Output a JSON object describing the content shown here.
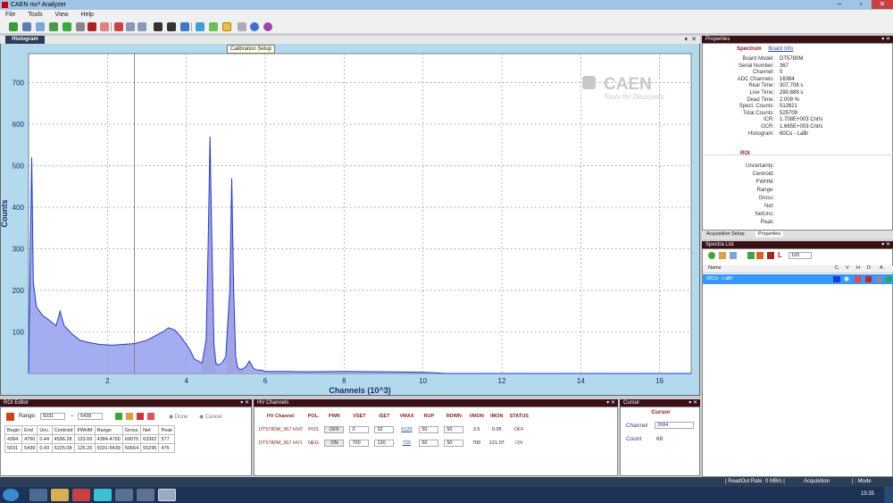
{
  "app": {
    "title": "CAEN mc² Analyzer"
  },
  "menu": [
    "File",
    "Tools",
    "View",
    "Help"
  ],
  "tooltip": "Calibration Setup",
  "histogram": {
    "tab": "Histogram",
    "logo_text": "CAEN",
    "logo_tagline": "Tools for Discovery"
  },
  "chart_data": {
    "type": "area",
    "xlabel": "Channels (10^3)",
    "ylabel": "Counts",
    "xlim": [
      0,
      16.8
    ],
    "ylim": [
      0,
      770
    ],
    "x_ticks": [
      2,
      4,
      6,
      8,
      10,
      12,
      14,
      16
    ],
    "y_ticks": [
      100,
      200,
      300,
      400,
      500,
      600,
      700
    ],
    "grid": true,
    "cursor_x": 2.684,
    "series": [
      {
        "name": "60Co - LaBr",
        "color": "#1f3bd6",
        "fill": "#9aa4ee",
        "x": [
          0.0,
          0.08,
          0.12,
          0.2,
          0.35,
          0.5,
          0.7,
          0.8,
          0.9,
          1.1,
          1.3,
          1.5,
          1.8,
          2.1,
          2.4,
          2.7,
          3.0,
          3.2,
          3.4,
          3.55,
          3.7,
          3.85,
          4.0,
          4.1,
          4.2,
          4.3,
          4.4,
          4.5,
          4.55,
          4.6,
          4.65,
          4.7,
          4.75,
          4.8,
          4.9,
          5.0,
          5.1,
          5.15,
          5.2,
          5.25,
          5.3,
          5.35,
          5.4,
          5.5,
          5.6,
          5.7,
          5.8,
          5.9,
          6.0,
          6.5,
          7.0,
          8.0,
          9.0,
          10.0,
          10.6,
          11.0,
          12.0,
          16.8
        ],
        "y": [
          0,
          520,
          220,
          160,
          140,
          130,
          115,
          150,
          115,
          95,
          80,
          75,
          70,
          68,
          70,
          72,
          80,
          90,
          100,
          110,
          105,
          90,
          70,
          55,
          35,
          30,
          25,
          80,
          300,
          570,
          300,
          70,
          25,
          20,
          25,
          40,
          200,
          470,
          200,
          40,
          15,
          10,
          10,
          15,
          30,
          12,
          8,
          8,
          5,
          5,
          4,
          5,
          4,
          3,
          0,
          0,
          0,
          0
        ]
      }
    ],
    "roi_regions": [
      {
        "x": [
          4.384,
          4.76
        ],
        "color": "#e88a5a"
      },
      {
        "x": [
          5.031,
          5.439
        ],
        "color": "#e88a5a"
      }
    ]
  },
  "properties": {
    "header": "Properties",
    "spectrum_title": "Spectrum",
    "board_link": "Board Info",
    "rows": [
      {
        "label": "Board Model:",
        "value": "DT5780M"
      },
      {
        "label": "Serial Number:",
        "value": "367"
      },
      {
        "label": "Channel:",
        "value": "0"
      },
      {
        "label": "ADC Channels:",
        "value": "16384"
      },
      {
        "label": "Real Time:",
        "value": "307.708 s"
      },
      {
        "label": "Live Time:",
        "value": "290.889 s"
      },
      {
        "label": "Dead Time:",
        "value": "2.009 %"
      },
      {
        "label": "Spect. Counts:",
        "value": "512621"
      },
      {
        "label": "Total Counts:",
        "value": "525709"
      },
      {
        "label": "ICR:",
        "value": "1.708E+003 Cnt/s"
      },
      {
        "label": "OCR:",
        "value": "1.665E+003 Cnt/s"
      },
      {
        "label": "Histogram:",
        "value": "60Co - LaBr"
      }
    ],
    "roi_title": "ROI",
    "roi_rows": [
      "Uncertainty:",
      "Centroid:",
      "FWHM:",
      "Range:",
      "Gross:",
      "Net:",
      "NetUnc:",
      "Peak:"
    ]
  },
  "right_tabs": [
    "Acquisition Setup",
    "Properties"
  ],
  "spectra_list": {
    "header": "Spectra List",
    "combo_value": "100",
    "columns": [
      "Name",
      "C",
      "V",
      "H",
      "D",
      "A"
    ],
    "rows": [
      {
        "name": "60Co - LaBr"
      }
    ]
  },
  "roi_editor": {
    "header": "ROI Editor",
    "range_label": "Range:",
    "range_from": "5031",
    "range_to": "5439",
    "done_label": "Done",
    "cancel_label": "Cancel",
    "columns": [
      "Begin",
      "End",
      "Unc.",
      "Centroid",
      "FWHM",
      "Range",
      "Gross",
      "Net",
      "Peak"
    ],
    "rows": [
      [
        "4384",
        "4760",
        "0.44",
        "4596.28",
        "123.69",
        "4384-4760",
        "69075",
        "63362",
        "577"
      ],
      [
        "5031",
        "5439",
        "0.43",
        "5225.08",
        "125.26",
        "5031-5439",
        "59664",
        "55295",
        "475"
      ]
    ]
  },
  "hv_channels": {
    "header": "HV Channels",
    "columns": [
      "HV Channel",
      "POL.",
      "PWR",
      "VSET",
      "ISET",
      "VMAX",
      "RUP",
      "RDWN",
      "VMON",
      "IMON",
      "STATUS"
    ],
    "rows": [
      {
        "name": "DT5780M_367 HV0",
        "pol": "POS",
        "pwr": "OFF",
        "vset": "0",
        "iset": "32",
        "vmax": "5120",
        "rup": "50",
        "rdwn": "50",
        "vmon": "3.5",
        "imon": "0.05",
        "status": "OFF",
        "status_color": "#8b1a1a"
      },
      {
        "name": "DT5780M_367 HV1",
        "pol": "NEG",
        "pwr": "ON",
        "vset": "700",
        "iset": "130",
        "vmax": "720",
        "rup": "50",
        "rdwn": "50",
        "vmon": "700",
        "imon": "121.07",
        "status": "ON",
        "status_color": "#1a8b1a"
      }
    ]
  },
  "cursor": {
    "header": "Cursor",
    "title": "Cursor",
    "channel_label": "Channel",
    "channel_value": "2684",
    "count_label": "Count",
    "count_value": "68"
  },
  "status": {
    "readout_label": "ReadOut Rate",
    "readout_value": "0",
    "readout_unit": "MB/s",
    "mode": "Acquisition",
    "mode_label": "Mode"
  },
  "taskbar": {
    "time": "15:35"
  }
}
